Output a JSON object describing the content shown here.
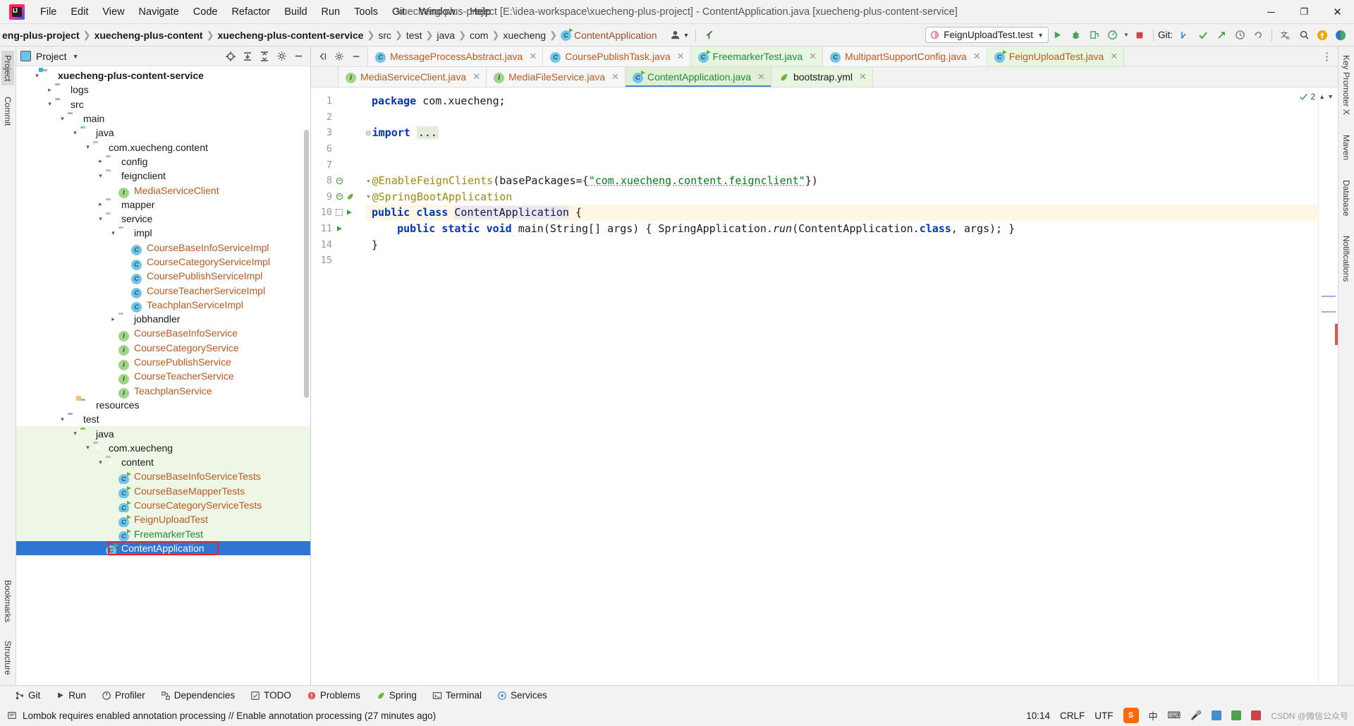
{
  "window": {
    "title": "xuecheng-plus-project [E:\\idea-workspace\\xuecheng-plus-project] - ContentApplication.java [xuecheng-plus-content-service]",
    "minimize": "─",
    "maximize": "❐",
    "close": "✕"
  },
  "menu": [
    {
      "label": "File"
    },
    {
      "label": "Edit"
    },
    {
      "label": "View"
    },
    {
      "label": "Navigate"
    },
    {
      "label": "Code"
    },
    {
      "label": "Refactor"
    },
    {
      "label": "Build"
    },
    {
      "label": "Run"
    },
    {
      "label": "Tools"
    },
    {
      "label": "Git"
    },
    {
      "label": "Window"
    },
    {
      "label": "Help"
    }
  ],
  "breadcrumbs": [
    {
      "label": "eng-plus-project",
      "style": "bold"
    },
    {
      "label": "xuecheng-plus-content",
      "style": "bold"
    },
    {
      "label": "xuecheng-plus-content-service",
      "style": "bold"
    },
    {
      "label": "src",
      "style": "dim"
    },
    {
      "label": "test",
      "style": "dim"
    },
    {
      "label": "java",
      "style": "dim"
    },
    {
      "label": "com",
      "style": "dim"
    },
    {
      "label": "xuecheng",
      "style": "dim"
    },
    {
      "label": "ContentApplication",
      "style": "class"
    }
  ],
  "toolbar": {
    "run_config": "FeignUploadTest.test",
    "git_label": "Git:",
    "run_icon": "run-icon",
    "debug_icon": "debug-icon",
    "coverage_icon": "coverage-icon",
    "profile_icon": "profile-icon",
    "stop_icon": "stop-icon",
    "update_project_icon": "git-update-icon",
    "commit_icon": "git-commit-icon",
    "push_icon": "git-push-icon",
    "history_icon": "history-icon",
    "rollback_icon": "rollback-icon",
    "translate_icon": "translate-icon",
    "search_icon": "search-everywhere-icon",
    "avatar_icon": "user-icon",
    "back_icon": "back-arrow-icon"
  },
  "project_panel": {
    "title": "Project",
    "locate_icon": "locate-icon",
    "expand_icon": "expand-all-icon",
    "collapse_icon": "collapse-all-icon",
    "hide_icon": "hide-icon",
    "settings_icon": "gear-icon",
    "tree": [
      {
        "depth": 1,
        "label": "xuecheng-plus-content-service",
        "arrow": "down",
        "icon": "folder-module",
        "style": "bold",
        "bg": "none"
      },
      {
        "depth": 2,
        "label": "logs",
        "arrow": "right",
        "icon": "folder-gray",
        "style": "normal",
        "bg": "none"
      },
      {
        "depth": 2,
        "label": "src",
        "arrow": "down",
        "icon": "folder-gray",
        "style": "normal",
        "bg": "none"
      },
      {
        "depth": 3,
        "label": "main",
        "arrow": "down",
        "icon": "folder-gray",
        "style": "normal",
        "bg": "none"
      },
      {
        "depth": 4,
        "label": "java",
        "arrow": "down",
        "icon": "folder-blue",
        "style": "normal",
        "bg": "none"
      },
      {
        "depth": 5,
        "label": "com.xuecheng.content",
        "arrow": "down",
        "icon": "folder-package",
        "style": "normal",
        "bg": "none"
      },
      {
        "depth": 6,
        "label": "config",
        "arrow": "right",
        "icon": "folder-package",
        "style": "normal",
        "bg": "none"
      },
      {
        "depth": 6,
        "label": "feignclient",
        "arrow": "down",
        "icon": "folder-package",
        "style": "normal",
        "bg": "none"
      },
      {
        "depth": 7,
        "label": "MediaServiceClient",
        "arrow": "none",
        "icon": "interface-icon",
        "style": "iface",
        "bg": "none"
      },
      {
        "depth": 6,
        "label": "mapper",
        "arrow": "right",
        "icon": "folder-package",
        "style": "normal",
        "bg": "none"
      },
      {
        "depth": 6,
        "label": "service",
        "arrow": "down",
        "icon": "folder-package",
        "style": "normal",
        "bg": "none"
      },
      {
        "depth": 7,
        "label": "impl",
        "arrow": "down",
        "icon": "folder-package",
        "style": "normal",
        "bg": "none"
      },
      {
        "depth": 8,
        "label": "CourseBaseInfoServiceImpl",
        "arrow": "none",
        "icon": "class-icon",
        "style": "class",
        "bg": "none"
      },
      {
        "depth": 8,
        "label": "CourseCategoryServiceImpl",
        "arrow": "none",
        "icon": "class-icon",
        "style": "class",
        "bg": "none"
      },
      {
        "depth": 8,
        "label": "CoursePublishServiceImpl",
        "arrow": "none",
        "icon": "class-icon",
        "style": "class",
        "bg": "none"
      },
      {
        "depth": 8,
        "label": "CourseTeacherServiceImpl",
        "arrow": "none",
        "icon": "class-icon",
        "style": "class",
        "bg": "none"
      },
      {
        "depth": 8,
        "label": "TeachplanServiceImpl",
        "arrow": "none",
        "icon": "class-icon",
        "style": "class",
        "bg": "none"
      },
      {
        "depth": 7,
        "label": "jobhandler",
        "arrow": "right",
        "icon": "folder-package",
        "style": "normal",
        "bg": "none"
      },
      {
        "depth": 7,
        "label": "CourseBaseInfoService",
        "arrow": "none",
        "icon": "interface-icon",
        "style": "iface",
        "bg": "none"
      },
      {
        "depth": 7,
        "label": "CourseCategoryService",
        "arrow": "none",
        "icon": "interface-icon",
        "style": "iface",
        "bg": "none"
      },
      {
        "depth": 7,
        "label": "CoursePublishService",
        "arrow": "none",
        "icon": "interface-icon",
        "style": "iface",
        "bg": "none"
      },
      {
        "depth": 7,
        "label": "CourseTeacherService",
        "arrow": "none",
        "icon": "interface-icon",
        "style": "iface",
        "bg": "none"
      },
      {
        "depth": 7,
        "label": "TeachplanService",
        "arrow": "none",
        "icon": "interface-icon",
        "style": "iface",
        "bg": "none"
      },
      {
        "depth": 4,
        "label": "resources",
        "arrow": "none",
        "icon": "folder-resources",
        "style": "normal",
        "bg": "none"
      },
      {
        "depth": 3,
        "label": "test",
        "arrow": "down",
        "icon": "folder-gray",
        "style": "normal",
        "bg": "none"
      },
      {
        "depth": 4,
        "label": "java",
        "arrow": "down",
        "icon": "folder-green",
        "style": "normal",
        "bg": "green"
      },
      {
        "depth": 5,
        "label": "com.xuecheng",
        "arrow": "down",
        "icon": "folder-package",
        "style": "normal",
        "bg": "green"
      },
      {
        "depth": 6,
        "label": "content",
        "arrow": "down",
        "icon": "folder-package",
        "style": "normal",
        "bg": "green"
      },
      {
        "depth": 7,
        "label": "CourseBaseInfoServiceTests",
        "arrow": "none",
        "icon": "class-run-icon",
        "style": "class",
        "bg": "green"
      },
      {
        "depth": 7,
        "label": "CourseBaseMapperTests",
        "arrow": "none",
        "icon": "class-run-icon",
        "style": "class",
        "bg": "green"
      },
      {
        "depth": 7,
        "label": "CourseCategoryServiceTests",
        "arrow": "none",
        "icon": "class-run-icon",
        "style": "class",
        "bg": "green"
      },
      {
        "depth": 7,
        "label": "FeignUploadTest",
        "arrow": "none",
        "icon": "class-run-icon",
        "style": "class",
        "bg": "green"
      },
      {
        "depth": 7,
        "label": "FreemarkerTest",
        "arrow": "none",
        "icon": "class-run-icon",
        "style": "green",
        "bg": "green"
      },
      {
        "depth": 6,
        "label": "ContentApplication",
        "arrow": "none",
        "icon": "spring-class-icon",
        "style": "selected",
        "bg": "selected",
        "boxed": true
      }
    ]
  },
  "left_strip": {
    "tabs": [
      "Project",
      "Commit",
      "Bookmarks",
      "Structure"
    ]
  },
  "right_strip": {
    "tabs": [
      "Key Promoter X",
      "Maven",
      "Database",
      "Notifications"
    ]
  },
  "editor": {
    "tabs_row1": [
      {
        "label": "MessageProcessAbstract.java",
        "icon": "class-icon",
        "state": "normal",
        "color": "java"
      },
      {
        "label": "CoursePublishTask.java",
        "icon": "class-icon",
        "state": "normal",
        "color": "java"
      },
      {
        "label": "FreemarkerTest.java",
        "icon": "class-run-icon",
        "state": "green",
        "color": "green"
      },
      {
        "label": "MultipartSupportConfig.java",
        "icon": "class-icon",
        "state": "normal",
        "color": "java"
      },
      {
        "label": "FeignUploadTest.java",
        "icon": "class-run-icon",
        "state": "green",
        "color": "java"
      }
    ],
    "tabs_row2": [
      {
        "label": "MediaServiceClient.java",
        "icon": "interface-icon",
        "state": "normal",
        "color": "java"
      },
      {
        "label": "MediaFileService.java",
        "icon": "interface-icon",
        "state": "normal",
        "color": "java"
      },
      {
        "label": "ContentApplication.java",
        "icon": "spring-class-icon",
        "state": "active",
        "color": "green"
      },
      {
        "label": "bootstrap.yml",
        "icon": "yaml-icon",
        "state": "normal",
        "color": "plain"
      }
    ],
    "line_numbers": [
      "1",
      "2",
      "3",
      "6",
      "7",
      "8",
      "9",
      "10",
      "11",
      "14",
      "15"
    ],
    "lines": [
      {
        "num": "1",
        "html": "package",
        "kind": "package"
      },
      {
        "num": "2",
        "html": "",
        "kind": "blank"
      },
      {
        "num": "3",
        "html": "import",
        "kind": "import"
      },
      {
        "num": "6",
        "html": "",
        "kind": "blank"
      },
      {
        "num": "7",
        "html": "",
        "kind": "blank"
      },
      {
        "num": "8",
        "html": "annotation-feign",
        "kind": "ann"
      },
      {
        "num": "9",
        "html": "annotation-springboot",
        "kind": "ann"
      },
      {
        "num": "10",
        "html": "class-decl",
        "kind": "class"
      },
      {
        "num": "11",
        "html": "main-method",
        "kind": "method"
      },
      {
        "num": "14",
        "html": "close-brace",
        "kind": "brace"
      },
      {
        "num": "15",
        "html": "",
        "kind": "blank"
      }
    ],
    "code": {
      "l1_kw": "package",
      "l1_pkg": "com.xuecheng;",
      "l3_kw": "import",
      "l3_dots": "...",
      "l8_ann": "@EnableFeignClients",
      "l8_open": "(basePackages={",
      "l8_str": "\"com.xuecheng.content.feignclient\"",
      "l8_close": "})",
      "l9_ann": "@SpringBootApplication",
      "l10_pub": "public",
      "l10_cls": "class",
      "l10_name": "ContentApplication",
      "l10_brace": "{",
      "l11_pub": "public",
      "l11_static": "static",
      "l11_void": "void",
      "l11_main": "main",
      "l11_args": "(String[] args)",
      "l11_body_open": "{ SpringApplication.",
      "l11_run": "run",
      "l11_body_mid": "(ContentApplication.",
      "l11_class_kw": "class",
      "l11_body_end": ", args); }",
      "l14_brace": "}"
    },
    "inspection_count": "2",
    "inspection_icon": "inspection-ok-icon",
    "up_arrow": "⌃",
    "down_arrow": "⌄"
  },
  "bottom_tools": [
    {
      "label": "Git",
      "icon": "git-icon"
    },
    {
      "label": "Run",
      "icon": "run-icon"
    },
    {
      "label": "Profiler",
      "icon": "profiler-icon"
    },
    {
      "label": "Dependencies",
      "icon": "dependencies-icon"
    },
    {
      "label": "TODO",
      "icon": "todo-icon"
    },
    {
      "label": "Problems",
      "icon": "problems-icon"
    },
    {
      "label": "Spring",
      "icon": "spring-icon"
    },
    {
      "label": "Terminal",
      "icon": "terminal-icon"
    },
    {
      "label": "Services",
      "icon": "services-icon"
    }
  ],
  "status": {
    "message": "Lombok requires enabled annotation processing // Enable annotation processing (27 minutes ago)",
    "message_icon": "notification-icon",
    "time": "10:14",
    "line_sep": "CRLF",
    "encoding": "UTF",
    "watermark": "CSDN @微信公众号",
    "tray_icons": [
      "ime-icon",
      "keyboard-icon",
      "mic-icon",
      "app-icon-1",
      "app-icon-2",
      "app-icon-3"
    ]
  },
  "colors": {
    "selection_blue": "#2f75d4",
    "test_green_bg": "#eef7e6",
    "highlight_red": "#ff1e1e",
    "keyword_blue": "#0033b3",
    "string_green": "#067d17",
    "annotation_yellow": "#9e880d",
    "class_orange": "#bb5a22"
  }
}
